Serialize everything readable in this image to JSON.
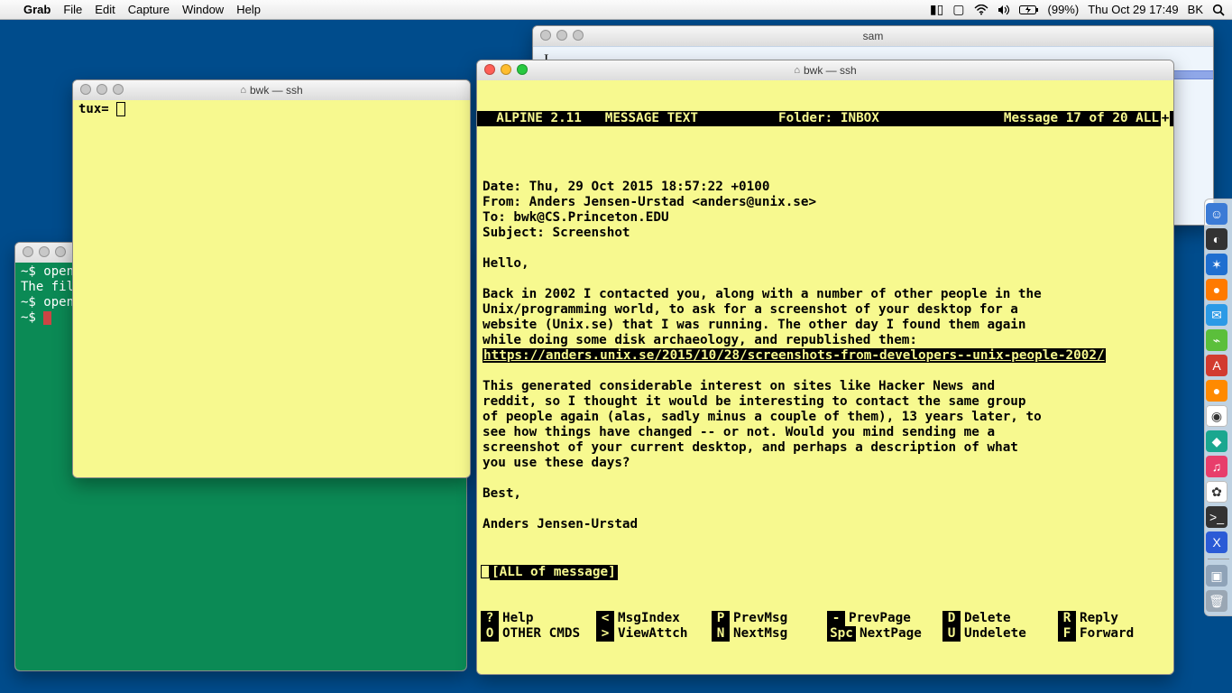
{
  "menubar": {
    "app": "Grab",
    "items": [
      "File",
      "Edit",
      "Capture",
      "Window",
      "Help"
    ],
    "battery": "(99%)",
    "clock": "Thu Oct 29  17:49",
    "user": "BK"
  },
  "sam_window": {
    "title": "sam"
  },
  "green_window": {
    "title": "",
    "lines": [
      "~$ open",
      "The fil",
      "~$ open",
      "~$ "
    ]
  },
  "yellow_small_window": {
    "title": "bwk — ssh",
    "prompt": "tux= "
  },
  "alpine_window": {
    "title": "bwk — ssh",
    "header": {
      "left": "  ALPINE 2.11   MESSAGE TEXT",
      "mid": "Folder: INBOX",
      "right": "Message 17 of 20 ALL"
    },
    "headers": {
      "date": "Date: Thu, 29 Oct 2015 18:57:22 +0100",
      "from": "From: Anders Jensen-Urstad <anders@unix.se>",
      "to": "To: bwk@CS.Princeton.EDU",
      "subject": "Subject: Screenshot"
    },
    "body": {
      "greeting": "Hello,",
      "p1": "Back in 2002 I contacted you, along with a number of other people in the\nUnix/programming world, to ask for a screenshot of your desktop for a\nwebsite (Unix.se) that I was running. The other day I found them again\nwhile doing some disk archaeology, and republished them:",
      "link": "https://anders.unix.se/2015/10/28/screenshots-from-developers--unix-people-2002/",
      "p2": "This generated considerable interest on sites like Hacker News and\nreddit, so I thought it would be interesting to contact the same group\nof people again (alas, sadly minus a couple of them), 13 years later, to\nsee how things have changed -- or not. Would you mind sending me a\nscreenshot of your current desktop, and perhaps a description of what\nyou use these days?",
      "closing": "Best,",
      "sig": "Anders Jensen-Urstad"
    },
    "status": "[ALL of message]",
    "commands": [
      {
        "k": "?",
        "l": "Help"
      },
      {
        "k": "<",
        "l": "MsgIndex"
      },
      {
        "k": "P",
        "l": "PrevMsg"
      },
      {
        "k": "-",
        "l": "PrevPage"
      },
      {
        "k": "D",
        "l": "Delete"
      },
      {
        "k": "R",
        "l": "Reply"
      },
      {
        "k": "O",
        "l": "OTHER CMDS"
      },
      {
        "k": ">",
        "l": "ViewAttch"
      },
      {
        "k": "N",
        "l": "NextMsg"
      },
      {
        "k": "Spc",
        "l": "NextPage"
      },
      {
        "k": "U",
        "l": "Undelete"
      },
      {
        "k": "F",
        "l": "Forward"
      }
    ]
  },
  "dock": [
    {
      "name": "finder",
      "bg": "#3b7bd6",
      "glyph": "☺"
    },
    {
      "name": "dashboard",
      "bg": "#333",
      "glyph": "◐"
    },
    {
      "name": "safari",
      "bg": "#1f6fd0",
      "glyph": "✶"
    },
    {
      "name": "firefox",
      "bg": "#ff7a00",
      "glyph": "●"
    },
    {
      "name": "mail",
      "bg": "#2b9ae6",
      "glyph": "✉"
    },
    {
      "name": "app-green",
      "bg": "#5bbf3b",
      "glyph": "⌁"
    },
    {
      "name": "acrobat",
      "bg": "#d23b2f",
      "glyph": "A"
    },
    {
      "name": "app-orange",
      "bg": "#ff8a00",
      "glyph": "●"
    },
    {
      "name": "chrome",
      "bg": "#ffffff",
      "glyph": "◉"
    },
    {
      "name": "app-teal",
      "bg": "#1aa78f",
      "glyph": "◆"
    },
    {
      "name": "itunes",
      "bg": "#e83e6b",
      "glyph": "♫"
    },
    {
      "name": "photos",
      "bg": "#ffffff",
      "glyph": "✿"
    },
    {
      "name": "terminal",
      "bg": "#333",
      "glyph": ">_"
    },
    {
      "name": "xcode",
      "bg": "#2b5bd6",
      "glyph": "X"
    },
    {
      "name": "sep"
    },
    {
      "name": "folder",
      "bg": "#8fa3b8",
      "glyph": "▣"
    },
    {
      "name": "trash",
      "bg": "#9aa7b4",
      "glyph": "🗑"
    }
  ]
}
